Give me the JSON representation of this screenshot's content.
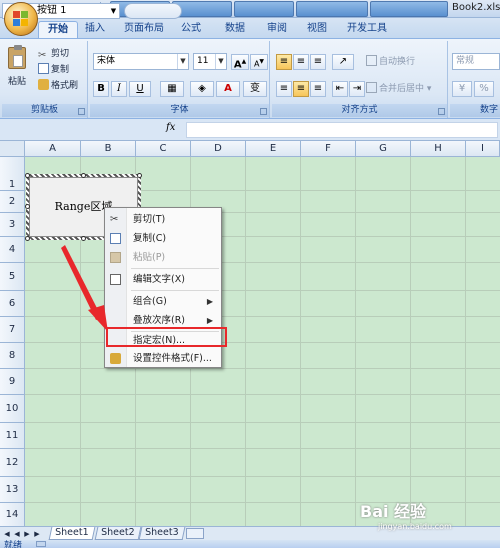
{
  "window": {
    "title": "Book2.xls"
  },
  "quick_access": {
    "items": [
      "save-icon",
      "undo-icon",
      "redo-icon"
    ]
  },
  "tabs": [
    {
      "label": "开始",
      "active": true
    },
    {
      "label": "插入"
    },
    {
      "label": "页面布局"
    },
    {
      "label": "公式"
    },
    {
      "label": "数据"
    },
    {
      "label": "审阅"
    },
    {
      "label": "视图"
    },
    {
      "label": "开发工具"
    }
  ],
  "ribbon": {
    "clipboard": {
      "paste": "粘贴",
      "cut": "剪切",
      "copy": "复制",
      "format_painter": "格式刷",
      "label": "剪贴板"
    },
    "font": {
      "name": "宋体",
      "size": "11",
      "grow": "A",
      "shrink": "A",
      "bold": "B",
      "italic": "I",
      "underline": "U",
      "label": "字体",
      "wen": "变"
    },
    "alignment": {
      "wrap": "自动换行",
      "merge": "合并后居中",
      "label": "对齐方式"
    },
    "number": {
      "format": "常规",
      "label": "数字"
    }
  },
  "formula_bar": {
    "name_box": "按钮 1",
    "fx": "fx",
    "formula": ""
  },
  "columns": [
    "A",
    "B",
    "C",
    "D",
    "E",
    "F",
    "G",
    "H",
    "I"
  ],
  "rows": [
    "1",
    "2",
    "3",
    "4",
    "5",
    "6",
    "7",
    "8",
    "9",
    "10",
    "11",
    "12",
    "13",
    "14"
  ],
  "form_button": {
    "text": "Range区域"
  },
  "context_menu": {
    "items": [
      {
        "label": "剪切(T)",
        "icon": "scissors-icon"
      },
      {
        "label": "复制(C)",
        "icon": "copy-icon"
      },
      {
        "label": "粘贴(P)",
        "icon": "paste-icon",
        "disabled": true
      },
      {
        "label": "编辑文字(X)",
        "icon": "edit-text-icon"
      },
      {
        "label": "组合(G)",
        "submenu": true
      },
      {
        "label": "叠放次序(R)",
        "submenu": true
      },
      {
        "label": "指定宏(N)...",
        "highlighted": true
      },
      {
        "label": "设置控件格式(F)...",
        "icon": "format-control-icon"
      }
    ]
  },
  "sheets": [
    {
      "label": "Sheet1",
      "active": true
    },
    {
      "label": "Sheet2"
    },
    {
      "label": "Sheet3"
    }
  ],
  "status": {
    "text": "就绪"
  },
  "watermark": {
    "brand": "Bai 经验",
    "url": "jingyan.baidu.com"
  },
  "colors": {
    "grid_bg": "#cce8cf",
    "ribbon_bg": "#dbe7f5",
    "highlight_red": "#e8282b",
    "accent_blue": "#15428b"
  }
}
